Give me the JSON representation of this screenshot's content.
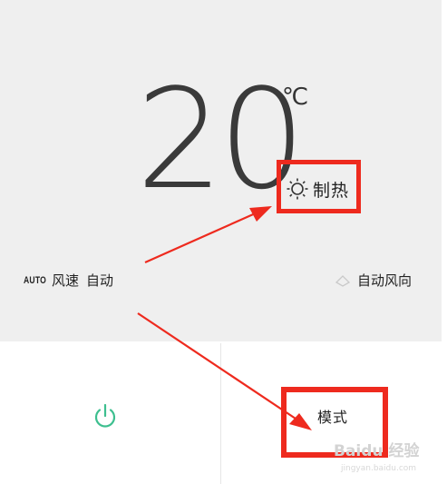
{
  "display": {
    "temperature": "20",
    "unit": "℃",
    "mode_label": "制热",
    "mode_icon": "sun-icon"
  },
  "fan": {
    "auto_badge": "AUTO",
    "speed_label": "风速",
    "speed_value": "自动",
    "direction_label": "自动风向",
    "direction_icon": "diamond-outline-icon"
  },
  "controls": {
    "power_icon": "power-icon",
    "mode_button_label": "模式"
  },
  "colors": {
    "panel_bg": "#efefef",
    "highlight_red": "#ee2a1e",
    "power_green": "#3dbf8f"
  },
  "watermark": {
    "brand": "Baidu 经验",
    "url": "jingyan.baidu.com"
  }
}
